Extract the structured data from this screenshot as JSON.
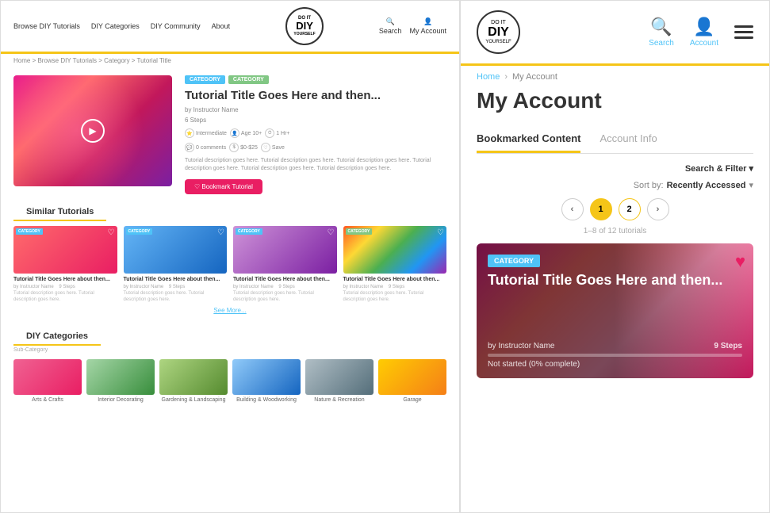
{
  "left": {
    "nav": {
      "links": [
        "Browse DIY Tutorials",
        "DIY Categories",
        "DIY Community",
        "About"
      ],
      "search_label": "Search",
      "account_label": "My Account",
      "logo": {
        "do_it": "DO IT",
        "diy": "DIY",
        "yourself": "YOURSELF"
      }
    },
    "breadcrumb": "Home > Browse DIY Tutorials > Category > Tutorial Title",
    "tutorial": {
      "tags": [
        "CATEGORY",
        "CATEGORY"
      ],
      "title": "Tutorial Title Goes Here and then...",
      "instructor": "by Instructor Name",
      "steps": "6 Steps",
      "description": "Tutorial description goes here. Tutorial description goes here. Tutorial description goes here. Tutorial description goes here. Tutorial description goes here. Tutorial description goes here.",
      "bookmark_label": "♡  Bookmark Tutorial"
    },
    "similar_header": "Similar Tutorials",
    "similar_cards": [
      {
        "tag": "CATEGORY",
        "title": "Tutorial Title Goes Here about then...",
        "instructor": "by Instructor Name",
        "steps": "9 Steps",
        "type": "red"
      },
      {
        "tag": "CATEGORY",
        "title": "Tutorial Title Goes Here about then...",
        "instructor": "by Instructor Name",
        "steps": "9 Steps",
        "type": "blue"
      },
      {
        "tag": "CATEGORY",
        "title": "Tutorial Title Goes Here about then...",
        "instructor": "by Instructor Name",
        "steps": "9 Steps",
        "type": "purple"
      },
      {
        "tag": "CATEGORY",
        "title": "Tutorial Title Goes Here about then...",
        "instructor": "by Instructor Name",
        "steps": "9 Steps",
        "type": "rainbow"
      }
    ],
    "see_more": "See More...",
    "categories_header": "DIY Categories",
    "categories": [
      {
        "label": "Arts & Crafts",
        "sub": "",
        "type": "crafts"
      },
      {
        "label": "Interior Decorating",
        "sub": "",
        "type": "interior"
      },
      {
        "label": "Gardening & Landscaping",
        "sub": "",
        "type": "garden"
      },
      {
        "label": "Building & Woodworking",
        "sub": "",
        "type": "woodwork"
      },
      {
        "label": "Nature & Recreation",
        "sub": "",
        "type": "nature"
      },
      {
        "label": "Garage",
        "sub": "",
        "type": "garage"
      }
    ]
  },
  "right": {
    "logo": {
      "do_it": "DO IT",
      "diy": "DIY",
      "yourself": "YOURSELF"
    },
    "nav": {
      "search_label": "Search",
      "account_label": "Account"
    },
    "breadcrumb": {
      "home": "Home",
      "current": "My Account"
    },
    "page_title": "My Account",
    "tabs": [
      {
        "label": "Bookmarked Content",
        "active": true
      },
      {
        "label": "Account Info",
        "active": false
      }
    ],
    "filter_label": "Search & Filter",
    "filter_chevron": "▾",
    "sort_prefix": "Sort by:",
    "sort_value": "Recently Accessed",
    "sort_chevron": "▾",
    "pagination": {
      "prev": "‹",
      "pages": [
        "1",
        "2"
      ],
      "next": "›",
      "active_page": "1"
    },
    "result_count": "1–8 of 12 tutorials",
    "card": {
      "category_tag": "CATEGORY",
      "title": "Tutorial Title Goes Here and then...",
      "instructor": "by Instructor Name",
      "steps": "9 Steps",
      "progress_percent": 0,
      "status": "Not started (0% complete)"
    }
  }
}
